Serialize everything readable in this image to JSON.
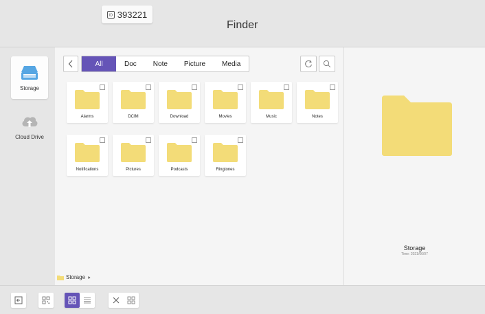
{
  "app": {
    "title": "Finder",
    "id_badge": "393221"
  },
  "sidebar": {
    "items": [
      {
        "label": "Storage",
        "icon": "storage-icon",
        "active": true
      },
      {
        "label": "Cloud Drive",
        "icon": "cloud-icon",
        "active": false
      }
    ]
  },
  "filter_tabs": [
    {
      "label": "All",
      "active": true
    },
    {
      "label": "Doc",
      "active": false
    },
    {
      "label": "Note",
      "active": false
    },
    {
      "label": "Picture",
      "active": false
    },
    {
      "label": "Media",
      "active": false
    }
  ],
  "folders": [
    {
      "name": "Alarms"
    },
    {
      "name": "DCIM"
    },
    {
      "name": "Download"
    },
    {
      "name": "Movies"
    },
    {
      "name": "Music"
    },
    {
      "name": "Notes"
    },
    {
      "name": "Notifications"
    },
    {
      "name": "Pictures"
    },
    {
      "name": "Podcasts"
    },
    {
      "name": "Ringtones"
    }
  ],
  "breadcrumb": {
    "label": "Storage"
  },
  "preview": {
    "name": "Storage",
    "time": "Time: 2021/06/07"
  },
  "colors": {
    "accent": "#6554b7",
    "folder": "#f3dc78",
    "storage_icon": "#56a6e3"
  }
}
